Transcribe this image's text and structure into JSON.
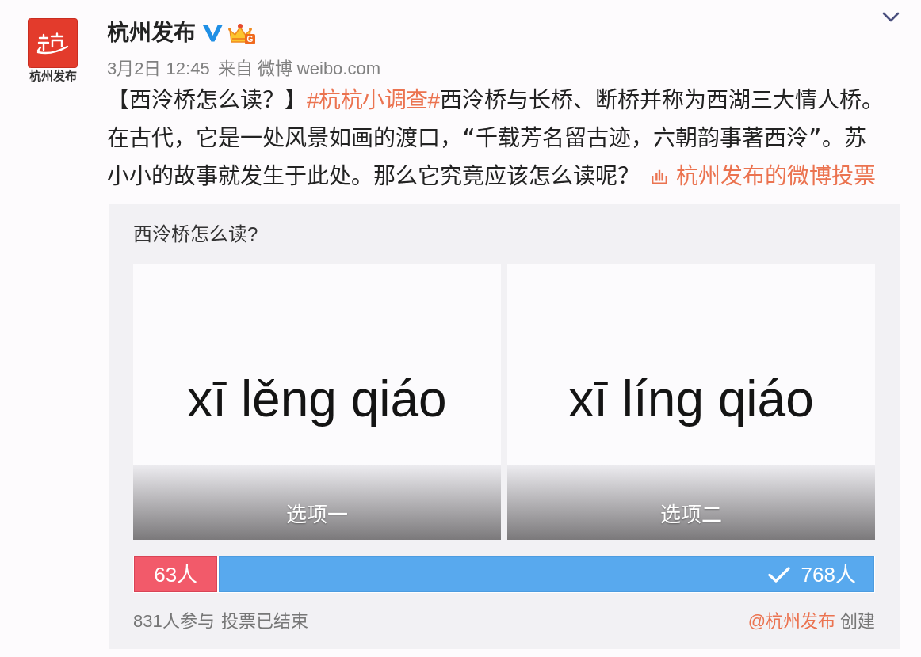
{
  "account": {
    "avatar_caption": "杭州发布",
    "name": "杭州发布",
    "verified": true,
    "member_badge": "G",
    "time": "3月2日 12:45",
    "source": "来自 微博 weibo.com"
  },
  "post": {
    "segments": [
      {
        "kind": "text",
        "text": "【西泠桥怎么读？】"
      },
      {
        "kind": "hashtag",
        "text": "#杭杭小调查#"
      },
      {
        "kind": "text",
        "text": "西泠桥与长桥、断桥并称为西湖三大情人桥。在古代，它是一处风景如画的渡口，“千载芳名留古迹，六朝韵事著西泠”。苏小小的故事就发生于此处。那么它究竟应该怎么读呢？"
      },
      {
        "kind": "poll_link",
        "text": "杭州发布的微博投票"
      }
    ]
  },
  "poll": {
    "title": "西泠桥怎么读?",
    "options": [
      {
        "image_text": "xī lěng qiáo",
        "label": "选项一"
      },
      {
        "image_text": "xī líng qiáo",
        "label": "选项二"
      }
    ],
    "results": [
      {
        "count": "63人",
        "level": 0.114,
        "color": "#f25a6a",
        "voted": false
      },
      {
        "count": "768人",
        "level": 0.886,
        "color": "#58a9ee",
        "voted": true
      }
    ],
    "participants": "831人参与",
    "status": "投票已结束",
    "creator": "@杭州发布",
    "creator_suffix": "创建"
  }
}
